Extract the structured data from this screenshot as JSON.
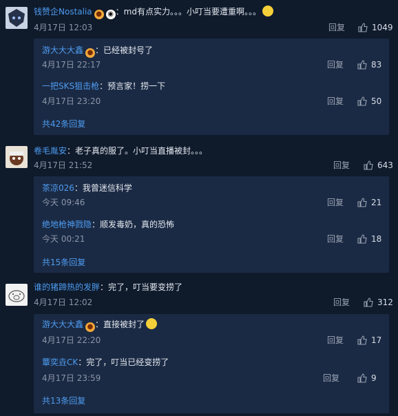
{
  "comments": [
    {
      "user": "钱赞企Nostalia",
      "badges": [
        "bear-badge-icon",
        "panda-badge-icon"
      ],
      "text": "：md有点实力。。。小叮当要遭重啊。。。",
      "emoji": "thinking-emoji",
      "date": "4月17日 12:03",
      "reply_label": "回复",
      "likes": "1049",
      "replies": [
        {
          "user": "游大大大鑫",
          "badge": "bear-badge-icon",
          "text": "：已经被封号了",
          "date": "4月17日 22:17",
          "reply_label": "回复",
          "likes": "83"
        },
        {
          "user": "一把SKS狙击枪",
          "text": "：预言家！捞一下",
          "date": "4月17日 23:20",
          "reply_label": "回复",
          "likes": "50"
        }
      ],
      "more": "共42条回复"
    },
    {
      "user": "卷毛胤安",
      "text": "：老子真的服了。小叮当直播被封。。。",
      "date": "4月17日 21:52",
      "reply_label": "回复",
      "likes": "643",
      "replies": [
        {
          "user": "茶凉026",
          "text": "：我曾迷信科学",
          "date": "今天 09:46",
          "reply_label": "回复",
          "likes": "21"
        },
        {
          "user": "绝地枪神戮隐",
          "text": "：顺发毒奶，真的恐怖",
          "date": "今天 00:21",
          "reply_label": "回复",
          "likes": "18"
        }
      ],
      "more": "共15条回复"
    },
    {
      "user": "谁的猪蹄热的发胖",
      "text": "：完了，叮当要变捞了",
      "date": "4月17日 12:02",
      "reply_label": "回复",
      "likes": "312",
      "replies": [
        {
          "user": "游大大大鑫",
          "badge": "bear-badge-icon",
          "text": "：直接被封了",
          "emoji": "laughing-emoji",
          "date": "4月17日 22:20",
          "reply_label": "回复",
          "likes": "17"
        },
        {
          "user": "蕈奕垚CK",
          "text": "：完了，叮当已经变捞了",
          "date": "4月17日 23:59",
          "reply_label": "回复",
          "likes": "9"
        }
      ],
      "more": "共13条回复"
    }
  ]
}
